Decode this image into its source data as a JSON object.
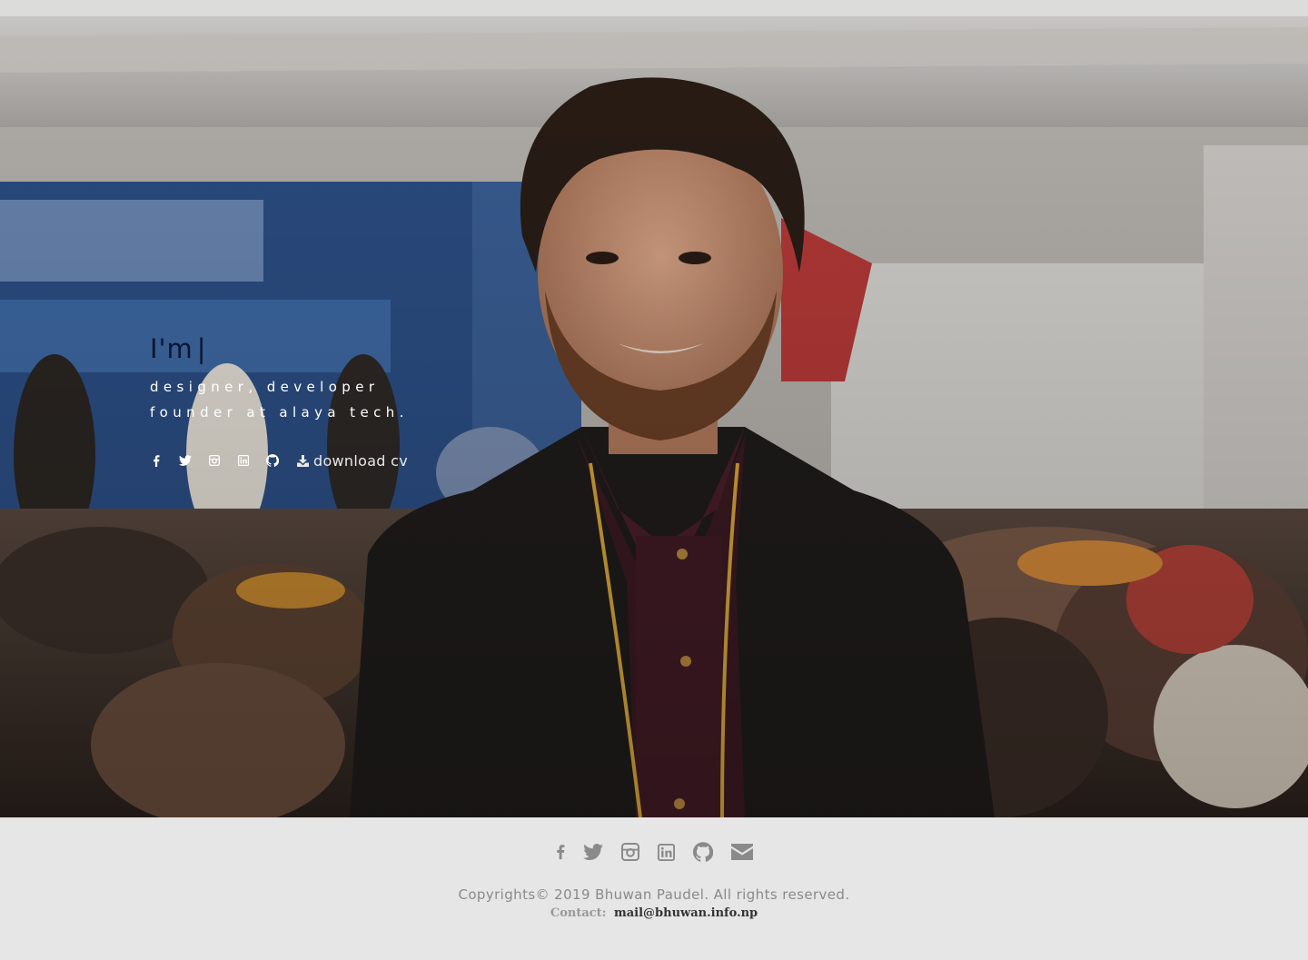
{
  "hero": {
    "greeting": "I'm",
    "cursor": "|",
    "role_line_1": "designer, developer",
    "role_line_2": "founder at alaya tech.",
    "download_label": "download cv",
    "social_icons": [
      "facebook-icon",
      "twitter-icon",
      "instagram-icon",
      "linkedin-icon",
      "github-icon"
    ]
  },
  "footer": {
    "social_icons": [
      "facebook-icon",
      "twitter-icon",
      "instagram-icon",
      "linkedin-icon",
      "github-icon",
      "envelope-icon"
    ],
    "copyright": "Copyrights© 2019 Bhuwan Paudel. All rights reserved.",
    "contact_label": "Contact:",
    "contact_email": "mail@bhuwan.info.np"
  },
  "colors": {
    "footer_bg": "#e6e6e6",
    "greeting_text": "#0c1330",
    "hero_text": "#ffffff",
    "footer_icon": "#8a8a8a"
  }
}
